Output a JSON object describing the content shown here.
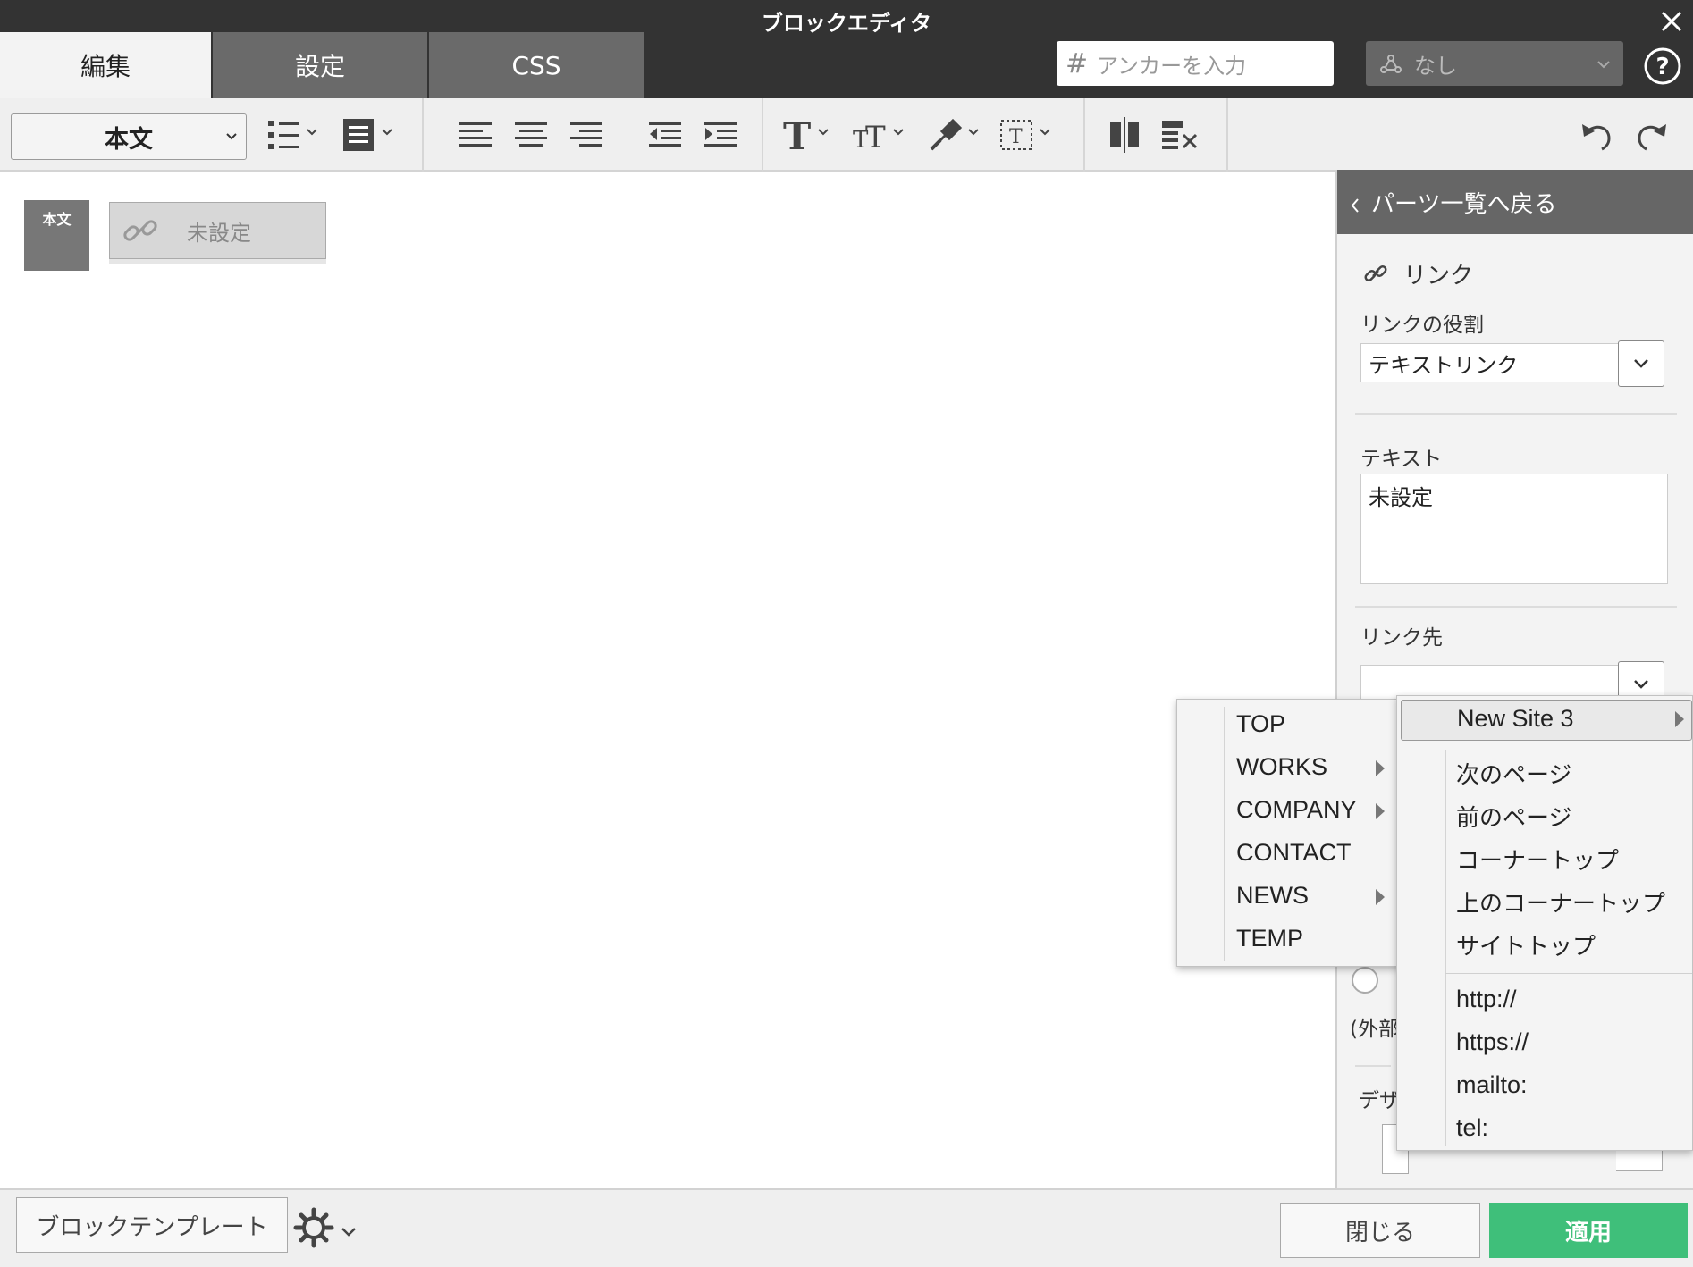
{
  "window": {
    "title": "ブロックエディタ"
  },
  "tabs": [
    {
      "label": "編集",
      "active": true
    },
    {
      "label": "設定",
      "active": false
    },
    {
      "label": "CSS",
      "active": false
    }
  ],
  "anchor": {
    "placeholder": "アンカーを入力"
  },
  "role_select": {
    "value": "なし"
  },
  "toolbar": {
    "style_select": "本文"
  },
  "canvas": {
    "block_tag": "本文",
    "link_part_label": "未設定"
  },
  "panel": {
    "back_label": "パーツ一覧へ戻る",
    "section_title": "リンク",
    "role_label": "リンクの役割",
    "role_value": "テキストリンク",
    "text_label": "テキスト",
    "text_value": "未設定",
    "dest_label": "リンク先",
    "dest_value": "",
    "partial_external": "(外部",
    "partial_design": "デザ"
  },
  "menu_left": {
    "items": [
      {
        "label": "TOP",
        "submenu": false
      },
      {
        "label": "WORKS",
        "submenu": true
      },
      {
        "label": "COMPANY",
        "submenu": true
      },
      {
        "label": "CONTACT",
        "submenu": false
      },
      {
        "label": "NEWS",
        "submenu": true
      },
      {
        "label": "TEMP",
        "submenu": false
      }
    ]
  },
  "menu_right": {
    "site": "New Site 3",
    "pages": [
      "次のページ",
      "前のページ",
      "コーナートップ",
      "上のコーナートップ",
      "サイトトップ"
    ],
    "protocols": [
      "http://",
      "https://",
      "mailto:",
      "tel:"
    ]
  },
  "footer": {
    "template_button": "ブロックテンプレート",
    "close_button": "閉じる",
    "apply_button": "適用"
  },
  "colors": {
    "header_bg": "#333333",
    "tab_inactive": "#6a6a6a",
    "apply_green": "#3fbf7a",
    "panel_header": "#666666"
  }
}
